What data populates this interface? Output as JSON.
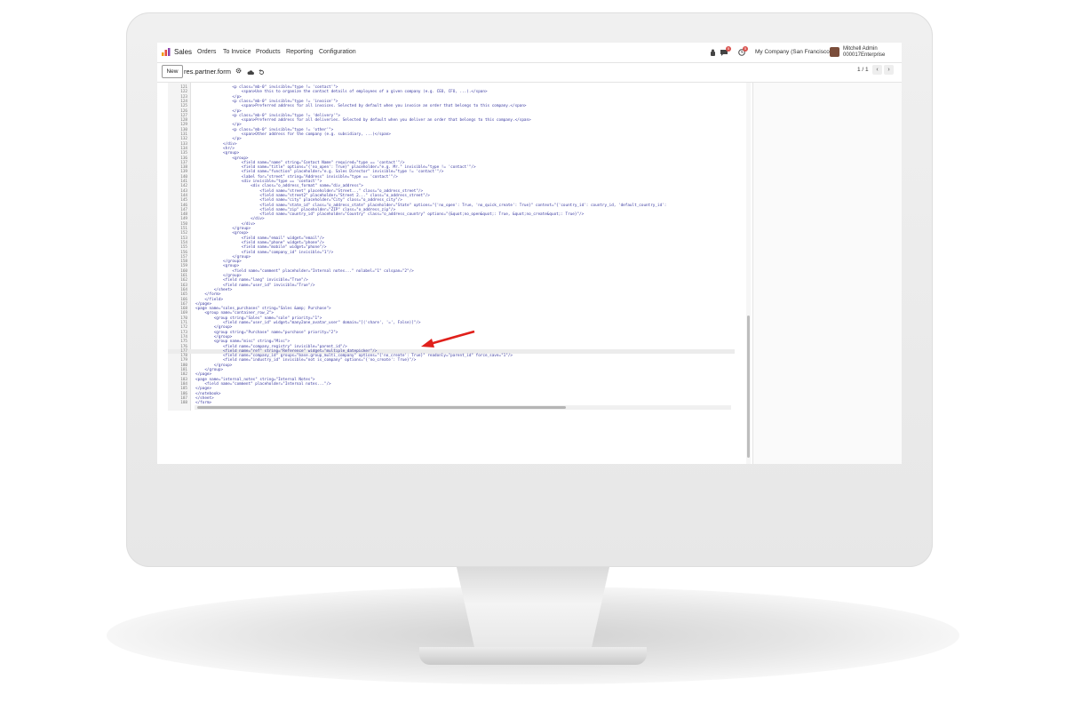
{
  "navbar": {
    "app_name": "Sales",
    "menu": [
      "Orders",
      "To Invoice",
      "Products",
      "Reporting",
      "Configuration"
    ],
    "chat_badge": "5",
    "activity_badge": "5",
    "company": "My Company (San Francisco)",
    "user_name": "Mitchell Admin",
    "database": "000017Enterprise"
  },
  "control_panel": {
    "new_label": "New",
    "breadcrumb": "res.partner.form",
    "pager": "1 / 1"
  },
  "editor": {
    "lines": [
      {
        "n": "121",
        "t": "                <p class=\"mb-0\" invisible=\"type != 'contact'\">"
      },
      {
        "n": "122",
        "t": "                    <span>Use this to organize the contact details of employees of a given company (e.g. CEO, CFO, ...).</span>"
      },
      {
        "n": "123",
        "t": "                </p>"
      },
      {
        "n": "124",
        "t": "                <p class=\"mb-0\" invisible=\"type != 'invoice'\">"
      },
      {
        "n": "125",
        "t": "                    <span>Preferred address for all invoices. Selected by default when you invoice an order that belongs to this company.</span>"
      },
      {
        "n": "126",
        "t": "                </p>"
      },
      {
        "n": "127",
        "t": "                <p class=\"mb-0\" invisible=\"type != 'delivery'\">"
      },
      {
        "n": "128",
        "t": "                    <span>Preferred address for all deliveries. Selected by default when you deliver an order that belongs to this company.</span>"
      },
      {
        "n": "129",
        "t": "                </p>"
      },
      {
        "n": "130",
        "t": "                <p class=\"mb-0\" invisible=\"type != 'other'\">"
      },
      {
        "n": "131",
        "t": "                    <span>Other address for the company (e.g. subsidiary, ...)</span>"
      },
      {
        "n": "132",
        "t": "                </p>"
      },
      {
        "n": "133",
        "t": "            </div>"
      },
      {
        "n": "134",
        "t": "            <hr/>"
      },
      {
        "n": "135",
        "t": "            <group>"
      },
      {
        "n": "136",
        "t": "                <group>"
      },
      {
        "n": "137",
        "t": "                    <field name=\"name\" string=\"Contact Name\" required=\"type == 'contact'\"/>"
      },
      {
        "n": "138",
        "t": "                    <field name=\"title\" options=\"{'no_open': True}\" placeholder=\"e.g. Mr.\" invisible=\"type != 'contact'\"/>"
      },
      {
        "n": "139",
        "t": "                    <field name=\"function\" placeholder=\"e.g. Sales Director\" invisible=\"type != 'contact'\"/>"
      },
      {
        "n": "140",
        "t": "                    <label for=\"street\" string=\"Address\" invisible=\"type == 'contact'\"/>"
      },
      {
        "n": "141",
        "t": "                    <div invisible=\"type == 'contact'\">"
      },
      {
        "n": "142",
        "t": "                        <div class=\"o_address_format\" name=\"div_address\">"
      },
      {
        "n": "143",
        "t": "                            <field name=\"street\" placeholder=\"Street...\" class=\"o_address_street\"/>"
      },
      {
        "n": "144",
        "t": "                            <field name=\"street2\" placeholder=\"Street 2...\" class=\"o_address_street\"/>"
      },
      {
        "n": "145",
        "t": "                            <field name=\"city\" placeholder=\"City\" class=\"o_address_city\"/>"
      },
      {
        "n": "146",
        "t": "                            <field name=\"state_id\" class=\"o_address_state\" placeholder=\"State\" options=\"{'no_open': True, 'no_quick_create': True}\" context=\"{'country_id': country_id, 'default_country_id':"
      },
      {
        "n": "147",
        "t": "                            <field name=\"zip\" placeholder=\"ZIP\" class=\"o_address_zip\"/>"
      },
      {
        "n": "148",
        "t": "                            <field name=\"country_id\" placeholder=\"Country\" class=\"o_address_country\" options=\"{&quot;no_open&quot;: True, &quot;no_create&quot;: True}\"/>"
      },
      {
        "n": "149",
        "t": "                        </div>"
      },
      {
        "n": "150",
        "t": "                    </div>"
      },
      {
        "n": "151",
        "t": "                </group>"
      },
      {
        "n": "152",
        "t": "                <group>"
      },
      {
        "n": "153",
        "t": "                    <field name=\"email\" widget=\"email\"/>"
      },
      {
        "n": "154",
        "t": "                    <field name=\"phone\" widget=\"phone\"/>"
      },
      {
        "n": "155",
        "t": "                    <field name=\"mobile\" widget=\"phone\"/>"
      },
      {
        "n": "156",
        "t": "                    <field name=\"company_id\" invisible=\"1\"/>"
      },
      {
        "n": "157",
        "t": "                </group>"
      },
      {
        "n": "158",
        "t": "            </group>"
      },
      {
        "n": "159",
        "t": "            <group>"
      },
      {
        "n": "160",
        "t": "                <field name=\"comment\" placeholder=\"Internal notes...\" nolabel=\"1\" colspan=\"2\"/>"
      },
      {
        "n": "161",
        "t": "            </group>"
      },
      {
        "n": "162",
        "t": "            <field name=\"lang\" invisible=\"True\"/>"
      },
      {
        "n": "163",
        "t": "            <field name=\"user_id\" invisible=\"True\"/>"
      },
      {
        "n": "164",
        "t": "        </sheet>"
      },
      {
        "n": "165",
        "t": "    </form>"
      },
      {
        "n": "166",
        "t": "    </field>"
      },
      {
        "n": "167",
        "t": "</page>"
      },
      {
        "n": "168",
        "t": "<page name=\"sales_purchases\" string=\"Sales &amp; Purchase\">"
      },
      {
        "n": "169",
        "t": "    <group name=\"container_row_2\">"
      },
      {
        "n": "170",
        "t": "        <group string=\"Sales\" name=\"sale\" priority=\"1\">"
      },
      {
        "n": "171",
        "t": "            <field name=\"user_id\" widget=\"many2one_avatar_user\" domain=\"[('share', '=', False)]\"/>"
      },
      {
        "n": "172",
        "t": "        </group>"
      },
      {
        "n": "173",
        "t": "        <group string=\"Purchase\" name=\"purchase\" priority=\"2\">"
      },
      {
        "n": "174",
        "t": "        </group>"
      },
      {
        "n": "175",
        "t": "        <group name=\"misc\" string=\"Misc\">"
      },
      {
        "n": "176",
        "t": "            <field name=\"company_registry\" invisible=\"parent_id\"/>"
      },
      {
        "n": "177",
        "t": "            <field name=\"ref\" string=\"Reference\" widget=\"multiple_datepicker\"/>",
        "hl": true
      },
      {
        "n": "178",
        "t": "            <field name=\"company_id\" groups=\"base.group_multi_company\" options=\"{'no_create': True}\" readonly=\"parent_id\" force_save=\"1\"/>"
      },
      {
        "n": "179",
        "t": "            <field name=\"industry_id\" invisible=\"not is_company\" options=\"{'no_create': True}\"/>"
      },
      {
        "n": "180",
        "t": "        </group>"
      },
      {
        "n": "181",
        "t": "    </group>"
      },
      {
        "n": "182",
        "t": "</page>"
      },
      {
        "n": "183",
        "t": "<page name=\"internal_notes\" string=\"Internal Notes\">"
      },
      {
        "n": "184",
        "t": "    <field name=\"comment\" placeholder=\"Internal notes...\"/>"
      },
      {
        "n": "185",
        "t": "</page>"
      },
      {
        "n": "186",
        "t": "</notebook>"
      },
      {
        "n": "187",
        "t": "</sheet>"
      },
      {
        "n": "188",
        "t": "</form>"
      }
    ]
  },
  "colors": {
    "code_tag": "#3a3aa0",
    "string": "#2e8b57",
    "highlight": "#bfe0f2",
    "arrow": "#e0201b"
  }
}
